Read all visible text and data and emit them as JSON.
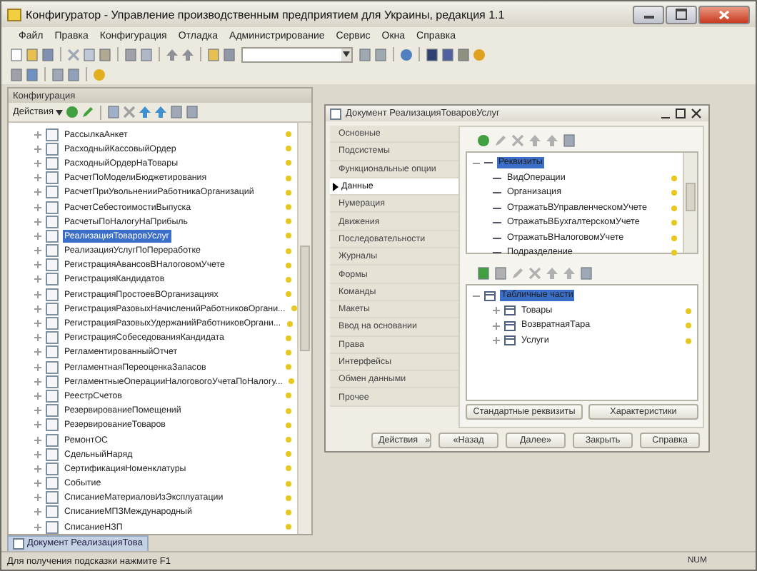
{
  "window": {
    "title": "Конфигуратор - Управление производственным предприятием для Украины, редакция 1.1"
  },
  "menu": [
    "Файл",
    "Правка",
    "Конфигурация",
    "Отладка",
    "Администрирование",
    "Сервис",
    "Окна",
    "Справка"
  ],
  "config_panel": {
    "title": "Конфигурация",
    "actions_label": "Действия",
    "items": [
      {
        "label": "РассылкаАнкет",
        "selected": false
      },
      {
        "label": "РасходныйКассовыйОрдер",
        "selected": false
      },
      {
        "label": "РасходныйОрдерНаТовары",
        "selected": false
      },
      {
        "label": "РасчетПоМоделиБюджетирования",
        "selected": false
      },
      {
        "label": "РасчетПриУвольненииРаботникаОрганизаций",
        "selected": false
      },
      {
        "label": "РасчетСебестоимостиВыпуска",
        "selected": false
      },
      {
        "label": "РасчетыПоНалогуНаПрибыль",
        "selected": false
      },
      {
        "label": "РеализацияТоваровУслуг",
        "selected": true
      },
      {
        "label": "РеализацияУслугПоПереработке",
        "selected": false
      },
      {
        "label": "РегистрацияАвансовВНалоговомУчете",
        "selected": false
      },
      {
        "label": "РегистрацияКандидатов",
        "selected": false
      },
      {
        "label": "РегистрацияПростоевВОрганизациях",
        "selected": false
      },
      {
        "label": "РегистрацияРазовыхНачисленийРаботниковОргани...",
        "selected": false
      },
      {
        "label": "РегистрацияРазовыхУдержанийРаботниковОргани...",
        "selected": false
      },
      {
        "label": "РегистрацияСобеседованияКандидата",
        "selected": false
      },
      {
        "label": "РегламентированныйОтчет",
        "selected": false
      },
      {
        "label": "РегламентнаяПереоценкаЗапасов",
        "selected": false
      },
      {
        "label": "РегламентныеОперацииНалоговогоУчетаПоНалогу...",
        "selected": false
      },
      {
        "label": "РеестрСчетов",
        "selected": false
      },
      {
        "label": "РезервированиеПомещений",
        "selected": false
      },
      {
        "label": "РезервированиеТоваров",
        "selected": false
      },
      {
        "label": "РемонтОС",
        "selected": false
      },
      {
        "label": "СдельныйНаряд",
        "selected": false
      },
      {
        "label": "СертификацияНоменклатуры",
        "selected": false
      },
      {
        "label": "Событие",
        "selected": false
      },
      {
        "label": "СписаниеМатериаловИзЭксплуатации",
        "selected": false
      },
      {
        "label": "СписаниеМПЗМеждународный",
        "selected": false
      },
      {
        "label": "СписаниеНЗП",
        "selected": false
      }
    ]
  },
  "dialog": {
    "title": "Документ РеализацияТоваровУслуг",
    "tabs": [
      {
        "label": "Основные",
        "selected": false
      },
      {
        "label": "Подсистемы",
        "selected": false
      },
      {
        "label": "Функциональные опции",
        "selected": false
      },
      {
        "label": "Данные",
        "selected": true
      },
      {
        "label": "Нумерация",
        "selected": false
      },
      {
        "label": "Движения",
        "selected": false
      },
      {
        "label": "Последовательности",
        "selected": false
      },
      {
        "label": "Журналы",
        "selected": false
      },
      {
        "label": "Формы",
        "selected": false
      },
      {
        "label": "Команды",
        "selected": false
      },
      {
        "label": "Макеты",
        "selected": false
      },
      {
        "label": "Ввод на основании",
        "selected": false
      },
      {
        "label": "Права",
        "selected": false
      },
      {
        "label": "Интерфейсы",
        "selected": false
      },
      {
        "label": "Обмен данными",
        "selected": false
      },
      {
        "label": "Прочее",
        "selected": false
      }
    ],
    "attributes_tree": {
      "label": "Реквизиты",
      "selected": true,
      "children": [
        {
          "label": "ВидОперации",
          "selected": false
        },
        {
          "label": "Организация",
          "selected": false
        },
        {
          "label": "ОтражатьВУправленческомУчете",
          "selected": false
        },
        {
          "label": "ОтражатьВБухгалтерскомУчете",
          "selected": false
        },
        {
          "label": "ОтражатьВНалоговомУчете",
          "selected": false
        },
        {
          "label": "Подразделение",
          "selected": false
        }
      ]
    },
    "tabular_tree": {
      "label": "Табличные части",
      "selected": true,
      "children": [
        {
          "label": "Товары",
          "selected": false
        },
        {
          "label": "ВозвратнаяТара",
          "selected": false
        },
        {
          "label": "Услуги",
          "selected": false
        }
      ]
    },
    "panel_buttons": [
      "Стандартные реквизиты",
      "Характеристики"
    ],
    "footer_buttons": [
      "Действия",
      "«Назад",
      "Далее»",
      "Закрыть",
      "Справка"
    ],
    "actions_arrow": "»"
  },
  "taskbar": {
    "label": "Документ РеализацияТова"
  },
  "status_bar": {
    "hint": "Для получения подсказки нажмите F1",
    "indicator": "NUM"
  }
}
